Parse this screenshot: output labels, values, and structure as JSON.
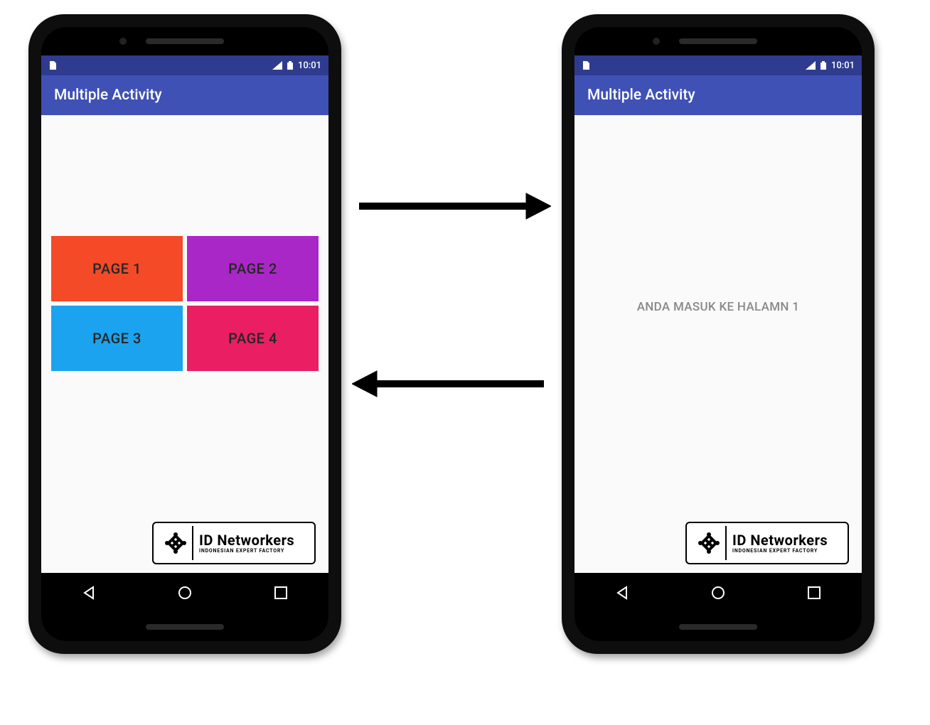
{
  "status": {
    "time": "10:01"
  },
  "app": {
    "title": "Multiple Activity"
  },
  "buttons": {
    "page1": "PAGE 1",
    "page2": "PAGE 2",
    "page3": "PAGE 3",
    "page4": "PAGE 4"
  },
  "detail": {
    "message": "ANDA MASUK KE HALAMN 1"
  },
  "logo": {
    "title": "ID Networkers",
    "subtitle": "INDONESIAN EXPERT FACTORY"
  },
  "colors": {
    "primary": "#3f51b5",
    "primary_dark": "#2f3b8f",
    "btn1": "#f44a27",
    "btn2": "#aa27c7",
    "btn3": "#1ba3ef",
    "btn4": "#e91e63"
  }
}
